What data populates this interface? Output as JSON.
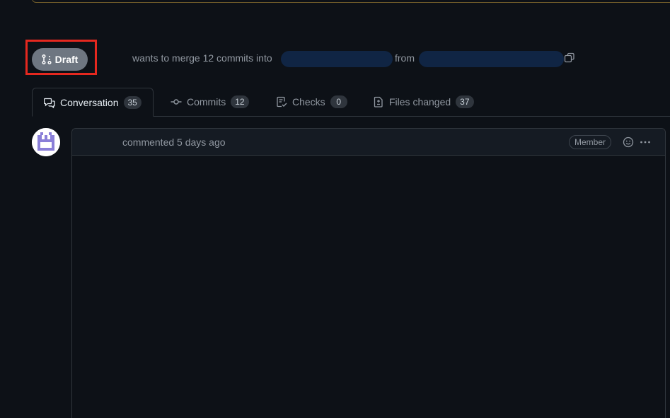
{
  "header": {
    "state_label": "Draft",
    "merge_text": "wants to merge 12 commits into",
    "from_text": "from"
  },
  "tabs": [
    {
      "label": "Conversation",
      "count": "35",
      "icon": "comment-discussion-icon"
    },
    {
      "label": "Commits",
      "count": "12",
      "icon": "git-commit-icon"
    },
    {
      "label": "Checks",
      "count": "0",
      "icon": "checklist-icon"
    },
    {
      "label": "Files changed",
      "count": "37",
      "icon": "file-diff-icon"
    }
  ],
  "comment": {
    "action_text": "commented 5 days ago",
    "role_badge": "Member"
  },
  "colors": {
    "background": "#0d1117",
    "draft_pill": "#6e7681",
    "highlight": "#e5281f"
  }
}
